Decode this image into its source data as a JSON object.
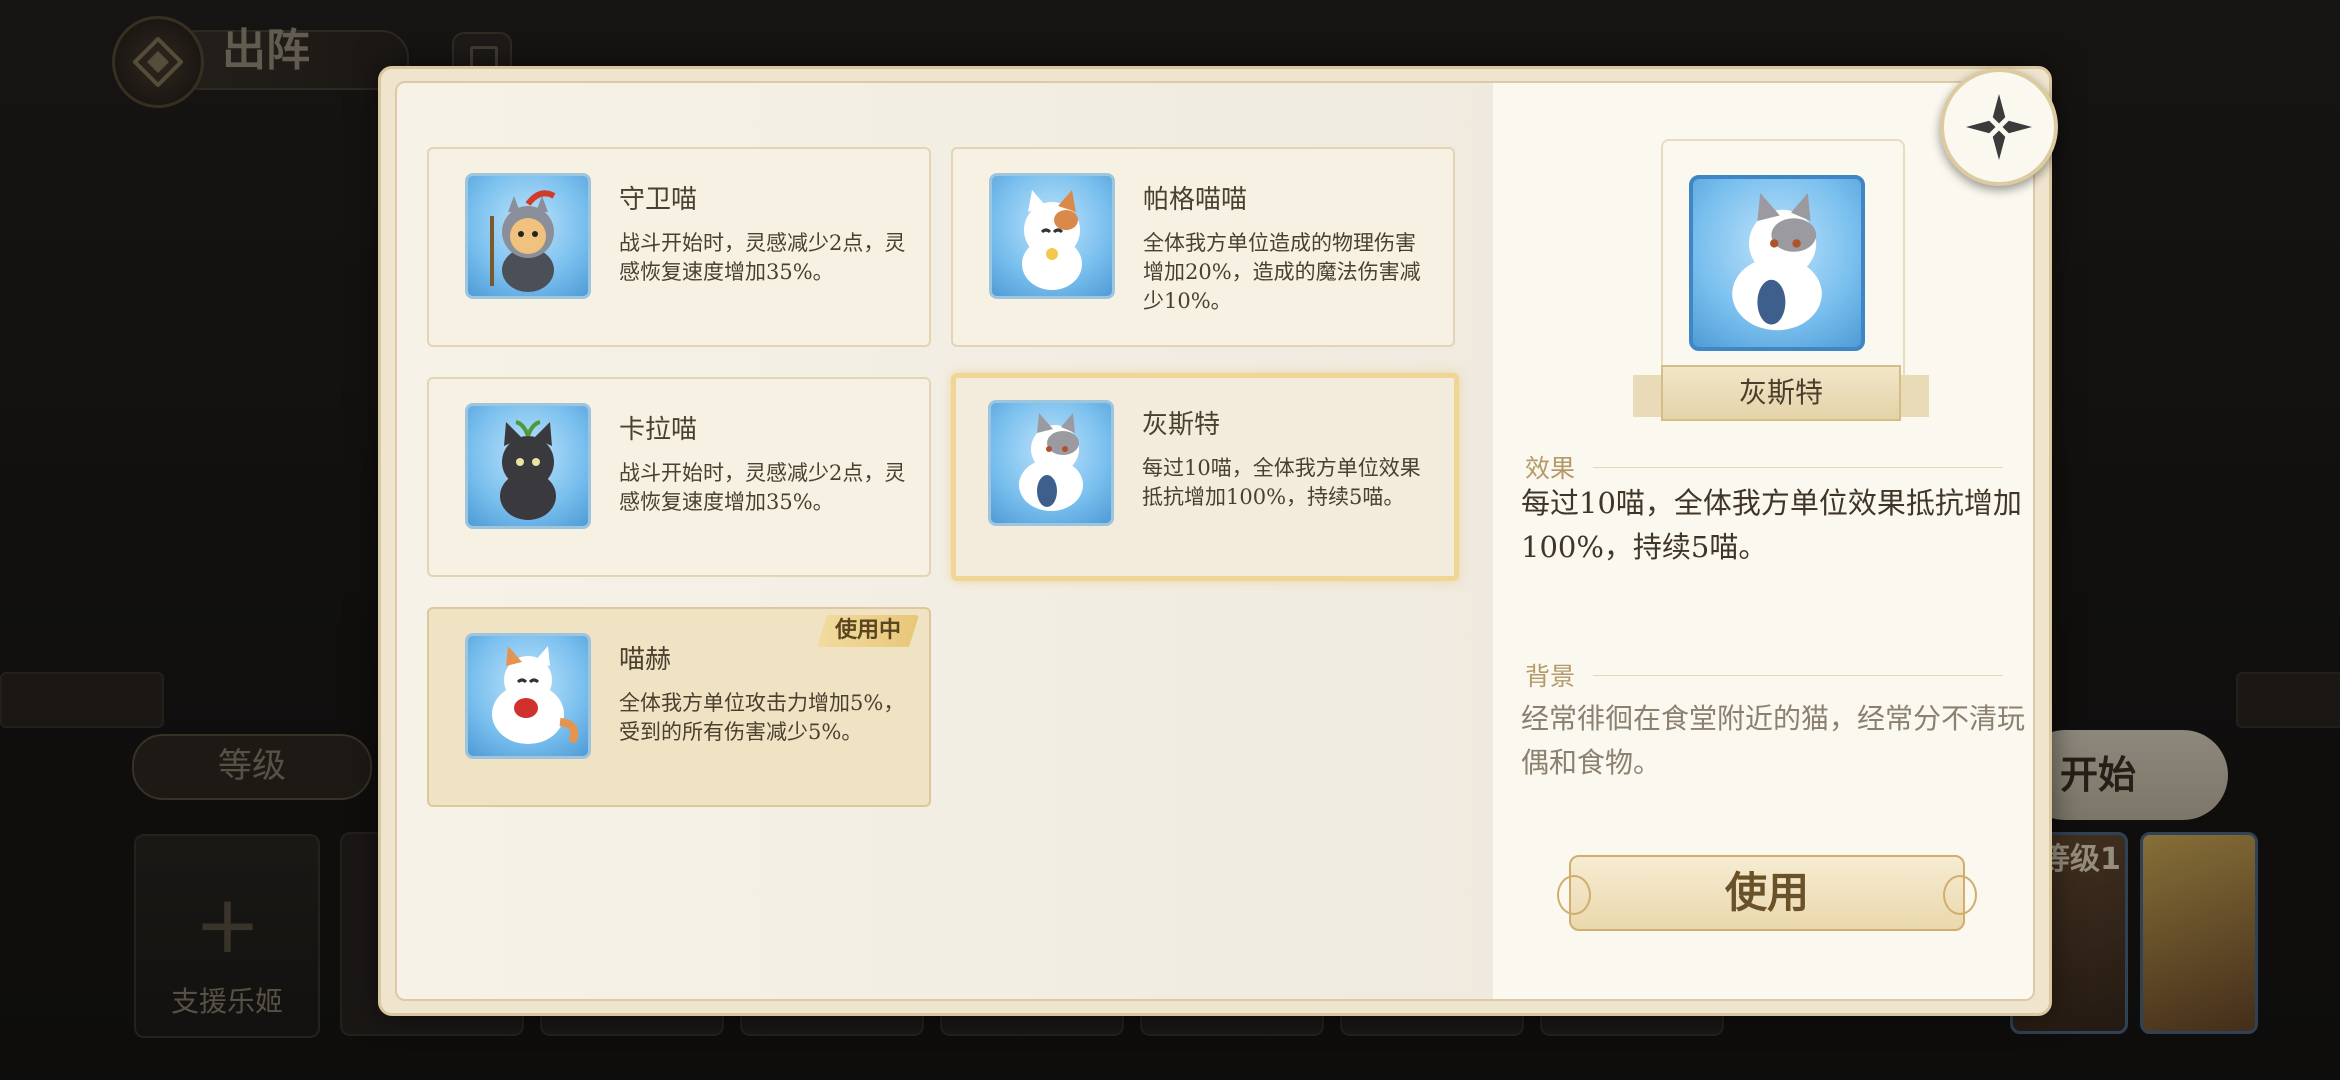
{
  "background": {
    "screen_title": "出阵",
    "level_label": "等级",
    "start_label": "开始",
    "support_label": "支援乐姬",
    "hero_level_text": "等级1"
  },
  "cats": [
    {
      "name": "守卫喵",
      "desc": "战斗开始时，灵感减少2点，灵感恢复速度增加35%。",
      "icon": "guard-cat-icon"
    },
    {
      "name": "帕格喵喵",
      "desc": "全体我方单位造成的物理伤害增加20%，造成的魔法伤害减少10%。",
      "icon": "calico-cat-icon"
    },
    {
      "name": "卡拉喵",
      "desc": "战斗开始时，灵感减少2点，灵感恢复速度增加35%。",
      "icon": "black-cat-icon"
    },
    {
      "name": "灰斯特",
      "desc": "每过10喵，全体我方单位效果抵抗增加100%，持续5喵。",
      "icon": "grey-cat-icon",
      "selected": true
    },
    {
      "name": "喵赫",
      "desc": "全体我方单位攻击力增加5%，受到的所有伤害减少5%。",
      "icon": "white-cat-icon",
      "in_use": true,
      "badge": "使用中"
    }
  ],
  "detail": {
    "name": "灰斯特",
    "effect_label": "效果",
    "effect_text": "每过10喵，全体我方单位效果抵抗增加100%，持续5喵。",
    "background_label": "背景",
    "background_text": "经常徘徊在食堂附近的猫，经常分不清玩偶和食物。",
    "use_button": "使用"
  },
  "colors": {
    "accent_gold": "#e8c678",
    "icon_blue": "#79bfee",
    "panel_cream": "#efe5cf"
  }
}
